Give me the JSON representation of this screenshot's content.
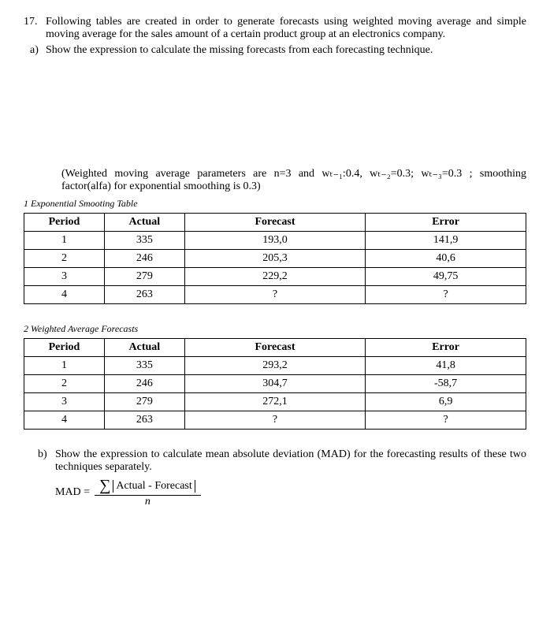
{
  "question": {
    "number": "17.",
    "text": "Following tables are created in order to generate forecasts using  weighted moving average and simple moving average for the sales amount of a certain product group at an electronics company."
  },
  "partA": {
    "marker": "a)",
    "text": "Show the expression to calculate the missing forecasts from each forecasting technique."
  },
  "paramText": "(Weighted moving average parameters are n=3 and wₜ₋₁:0.4, wₜ₋₂=0.3; wₜ₋₃=0.3 ; smoothing factor(alfa) for exponential smoothing is 0.3)",
  "table1": {
    "caption": "1 Exponential Smooting Table",
    "headers": {
      "period": "Period",
      "actual": "Actual",
      "forecast": "Forecast",
      "error": "Error"
    },
    "rows": [
      {
        "period": "1",
        "actual": "335",
        "forecast": "193,0",
        "error": "141,9"
      },
      {
        "period": "2",
        "actual": "246",
        "forecast": "205,3",
        "error": "40,6"
      },
      {
        "period": "3",
        "actual": "279",
        "forecast": "229,2",
        "error": "49,75"
      },
      {
        "period": "4",
        "actual": "263",
        "forecast": "?",
        "error": "?"
      }
    ]
  },
  "table2": {
    "caption": "2 Weighted Average Forecasts",
    "headers": {
      "period": "Period",
      "actual": "Actual",
      "forecast": "Forecast",
      "error": "Error"
    },
    "rows": [
      {
        "period": "1",
        "actual": "335",
        "forecast": "293,2",
        "error": "41,8"
      },
      {
        "period": "2",
        "actual": "246",
        "forecast": "304,7",
        "error": "-58,7"
      },
      {
        "period": "3",
        "actual": "279",
        "forecast": "272,1",
        "error": "6,9"
      },
      {
        "period": "4",
        "actual": "263",
        "forecast": "?",
        "error": "?"
      }
    ]
  },
  "partB": {
    "marker": "b)",
    "text": "Show the expression to calculate mean absolute deviation (MAD) for the forecasting results of these two techniques separately."
  },
  "formula": {
    "lhs": "MAD =",
    "sigma": "∑",
    "abs": "Actual - Forecast",
    "den": "n"
  }
}
